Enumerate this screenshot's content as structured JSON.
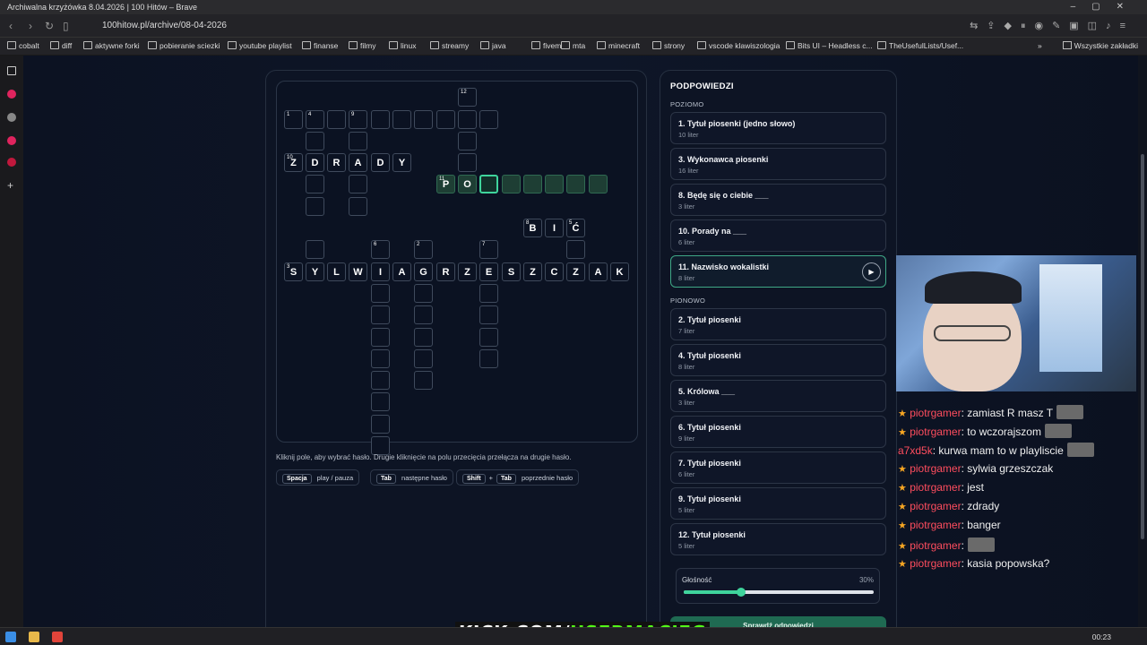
{
  "browser": {
    "window_title": "Archiwalna krzyżówka 8.04.2026 | 100 Hitów – Brave",
    "url": "100hitow.pl/archive/08-04-2026",
    "bookmarks": [
      "cobalt",
      "diff",
      "aktywne forki",
      "pobieranie sciezki",
      "youtube playlist",
      "finanse",
      "filmy",
      "linux",
      "streamy",
      "java",
      "fivem",
      "mta",
      "minecraft",
      "strony",
      "vscode klawiszologia",
      "Bits UI – Headless c...",
      "TheUsefulLists/Usef..."
    ],
    "bookmarks_more": "»",
    "all_bookmarks": "Wszystkie zakładki"
  },
  "crossword": {
    "cells": [
      {
        "num": "12"
      },
      {
        "num": "1"
      },
      {
        "num": "4"
      },
      {},
      {
        "num": "9"
      },
      {},
      {},
      {},
      {},
      {},
      {},
      {},
      {},
      {},
      {
        "num": "10",
        "letter": "Z"
      },
      {
        "letter": "D"
      },
      {
        "letter": "R"
      },
      {
        "letter": "A"
      },
      {
        "letter": "D"
      },
      {
        "letter": "Y"
      },
      {},
      {
        "num": "11",
        "letter": "P"
      },
      {
        "letter": "O"
      },
      {},
      {},
      {},
      {},
      {},
      {},
      {},
      {},
      {},
      {},
      {
        "num": "8",
        "letter": "B"
      },
      {
        "letter": "I"
      },
      {
        "num": "5",
        "letter": "Ć"
      },
      {},
      {
        "num": "6"
      },
      {
        "num": "2"
      },
      {
        "num": "7"
      },
      {},
      {
        "num": "3",
        "letter": "S"
      },
      {
        "letter": "Y"
      },
      {
        "letter": "L"
      },
      {
        "letter": "W"
      },
      {
        "letter": "I"
      },
      {
        "letter": "A"
      },
      {
        "letter": "G"
      },
      {
        "letter": "R"
      },
      {
        "letter": "Z"
      },
      {
        "letter": "E"
      },
      {
        "letter": "S"
      },
      {
        "letter": "Z"
      },
      {
        "letter": "C"
      },
      {
        "letter": "Z"
      },
      {
        "letter": "A"
      },
      {
        "letter": "K"
      },
      {},
      {},
      {},
      {},
      {},
      {},
      {},
      {},
      {},
      {},
      {},
      {},
      {},
      {},
      {},
      {},
      {},
      {}
    ],
    "hint": "Kliknij pole, aby wybrać hasło. Drugie kliknięcie na polu przecięcia przełącza na drugie hasło.",
    "shortcuts": [
      {
        "keys": [
          "Spacja"
        ],
        "label": "play / pauza"
      },
      {
        "keys": [
          "Tab"
        ],
        "label": "następne hasło"
      },
      {
        "keys": [
          "Shift",
          "Tab"
        ],
        "sep": "+",
        "label": "poprzednie hasło"
      }
    ]
  },
  "clues": {
    "title": "PODPOWIEDZI",
    "across_label": "POZIOMO",
    "down_label": "PIONOWO",
    "across": [
      {
        "text": "1. Tytuł piosenki (jedno słowo)",
        "len": "10 liter"
      },
      {
        "text": "3. Wykonawca piosenki",
        "len": "16 liter"
      },
      {
        "text": "8. Będę się o ciebie ___",
        "len": "3 liter"
      },
      {
        "text": "10. Porady na ___",
        "len": "6 liter"
      },
      {
        "text": "11. Nazwisko wokalistki",
        "len": "8 liter",
        "play": "▶"
      }
    ],
    "down": [
      {
        "text": "2. Tytuł piosenki",
        "len": "7 liter"
      },
      {
        "text": "4. Tytuł piosenki",
        "len": "8 liter"
      },
      {
        "text": "5. Królowa ___",
        "len": "3 liter"
      },
      {
        "text": "6. Tytuł piosenki",
        "len": "9 liter"
      },
      {
        "text": "7. Tytuł piosenki",
        "len": "6 liter"
      },
      {
        "text": "9. Tytuł piosenki",
        "len": "5 liter"
      },
      {
        "text": "12. Tytuł piosenki",
        "len": "5 liter"
      }
    ],
    "volume": {
      "label": "Głośność",
      "pct": "30%",
      "value": 0.3
    },
    "check_button": "Sprawdź odpowiedzi"
  },
  "chat": [
    {
      "user": "piotrgamer",
      "text": ": zamiast R masz T",
      "emote": true
    },
    {
      "user": "piotrgamer",
      "text": ": to wczorajszom",
      "emote": true
    },
    {
      "user": "a7xd5k",
      "text": ": kurwa mam to w playliscie",
      "emote": true,
      "nostar": true
    },
    {
      "user": "piotrgamer",
      "text": ": sylwia grzeszczak"
    },
    {
      "user": "piotrgamer",
      "text": ": jest"
    },
    {
      "user": "piotrgamer",
      "text": ": zdrady"
    },
    {
      "user": "piotrgamer",
      "text": ": banger"
    },
    {
      "user": "piotrgamer",
      "text": ":",
      "emote": true
    },
    {
      "user": "piotrgamer",
      "text": ": kasia popowska?"
    }
  ],
  "overlay": {
    "kick_white": "KICK.COM/",
    "kick_green": "USERMACIEG"
  },
  "taskbar": {
    "time": "00:23"
  }
}
